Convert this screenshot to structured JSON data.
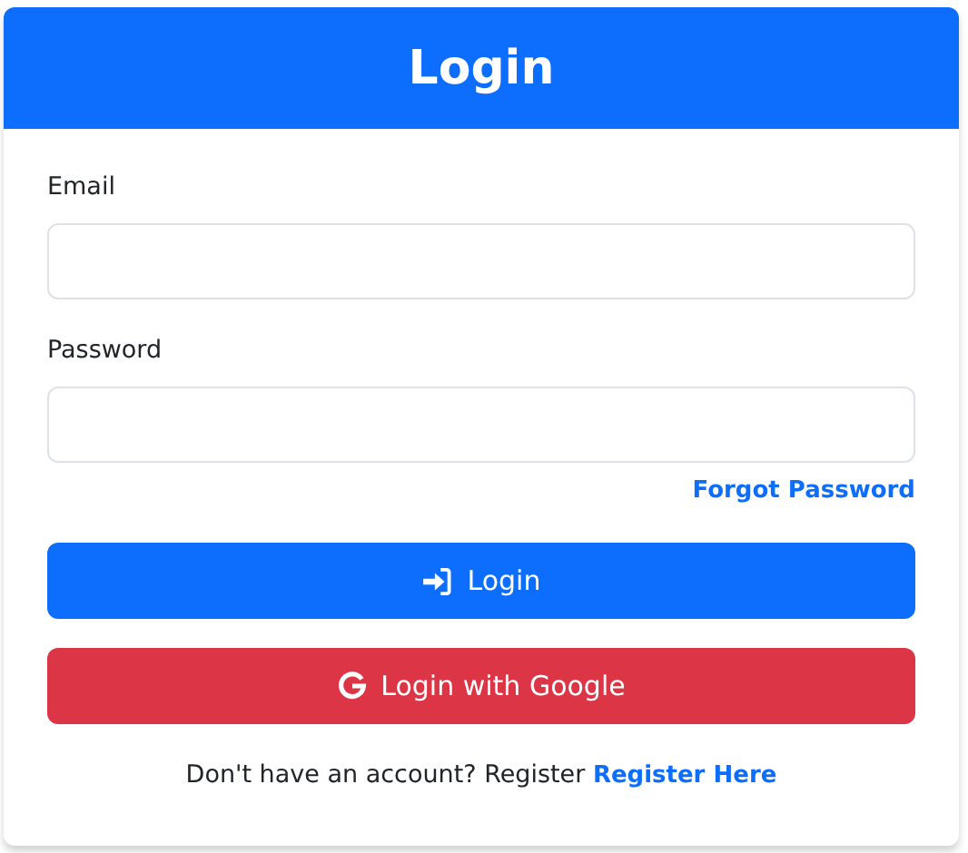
{
  "card": {
    "title": "Login"
  },
  "fields": [
    {
      "label": "Email"
    },
    {
      "label": "Password"
    }
  ],
  "forgot_link": "Forgot Password",
  "buttons": [
    {
      "kind": "primary",
      "label": "Login"
    },
    {
      "kind": "danger",
      "label": "Login with Google"
    }
  ],
  "footer": {
    "text": "Don't have an account? Register",
    "link": "Register Here"
  }
}
